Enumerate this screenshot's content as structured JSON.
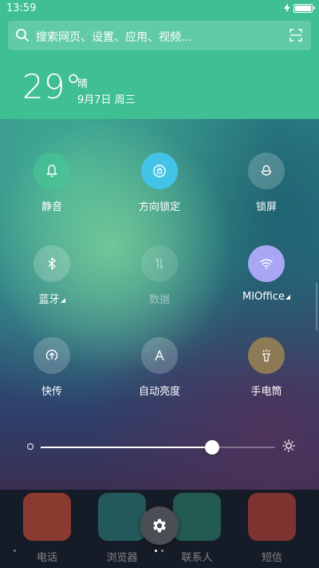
{
  "status_bar": {
    "time": "13:59",
    "charging": true,
    "battery_level": 1.0
  },
  "search": {
    "placeholder": "搜索网页、设置、应用、视频…",
    "icon": "search-icon",
    "scan_icon": "scan-icon"
  },
  "weather": {
    "temperature": "29°",
    "condition": "晴",
    "date": "9月7日  周三"
  },
  "toggles": [
    {
      "id": "mute",
      "label": "静音",
      "icon": "bell-icon",
      "color": "#46c896",
      "enabled": true
    },
    {
      "id": "rotation-lock",
      "label": "方向锁定",
      "icon": "rotation-lock-icon",
      "color": "#43c3e6",
      "enabled": true
    },
    {
      "id": "lock-screen",
      "label": "锁屏",
      "icon": "lock-icon",
      "enabled": true
    },
    {
      "id": "bluetooth",
      "label": "蓝牙",
      "icon": "bluetooth-icon",
      "has_menu": true,
      "enabled": true
    },
    {
      "id": "data",
      "label": "数据",
      "icon": "data-icon",
      "enabled": false
    },
    {
      "id": "wifi",
      "label": "MIOffice",
      "icon": "wifi-icon",
      "color": "#a9a6f4",
      "has_menu": true,
      "enabled": true
    },
    {
      "id": "quick-share",
      "label": "快传",
      "icon": "quick-transfer-icon",
      "enabled": true
    },
    {
      "id": "auto-brightness",
      "label": "自动亮度",
      "icon": "auto-brightness-icon",
      "enabled": true
    },
    {
      "id": "flashlight",
      "label": "手电筒",
      "icon": "flashlight-icon",
      "color": "#aa8c50",
      "enabled": true
    }
  ],
  "brightness": {
    "value": 0.73,
    "low_icon": "brightness-low-icon",
    "high_icon": "brightness-high-icon"
  },
  "dock": {
    "apps": [
      {
        "label": "电话",
        "color": "#8a3a2e"
      },
      {
        "label": "浏览器",
        "color": "#23595a"
      },
      {
        "label": "联系人",
        "color": "#235a52"
      },
      {
        "label": "短信",
        "color": "#7e3330"
      }
    ]
  },
  "settings_button": {
    "icon": "gear-icon"
  },
  "page_indicator": {
    "count": 2,
    "active": 0
  }
}
